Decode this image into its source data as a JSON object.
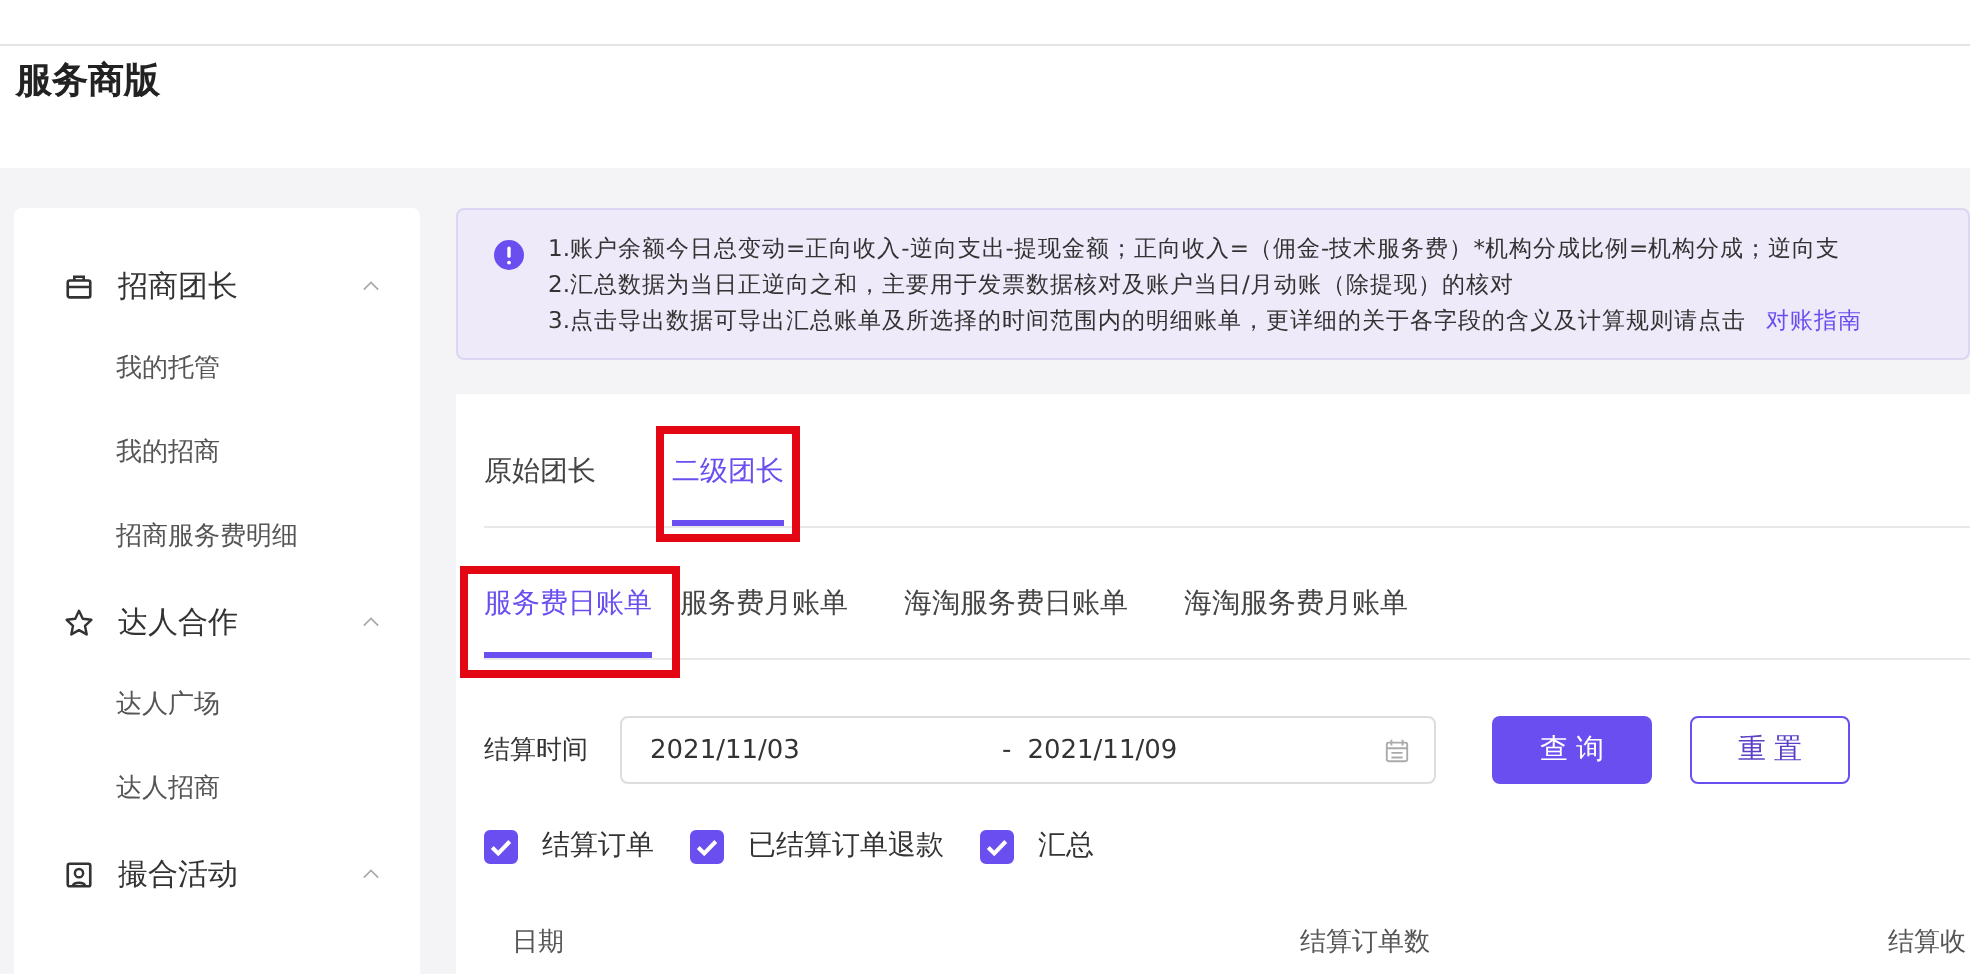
{
  "header": {
    "title": "服务商版"
  },
  "sidebar": {
    "groups": [
      {
        "kind": "briefcase",
        "label": "招商团长",
        "expanded": true,
        "items": [
          {
            "label": "我的托管"
          },
          {
            "label": "我的招商"
          },
          {
            "label": "招商服务费明细"
          }
        ]
      },
      {
        "kind": "star",
        "label": "达人合作",
        "expanded": true,
        "items": [
          {
            "label": "达人广场"
          },
          {
            "label": "达人招商"
          }
        ]
      },
      {
        "kind": "badge",
        "label": "撮合活动",
        "expanded": true
      }
    ]
  },
  "notice": {
    "lines": [
      "1.账户余额今日总变动=正向收入-逆向支出-提现金额；正向收入=（佣金-技术服务费）*机构分成比例=机构分成；逆向支",
      "2.汇总数据为当日正逆向之和，主要用于发票数据核对及账户当日/月动账（除提现）的核对",
      "3.点击导出数据可导出汇总账单及所选择的时间范围内的明细账单，更详细的关于各字段的含义及计算规则请点击"
    ],
    "link": "对账指南"
  },
  "role_tabs": [
    {
      "label": "原始团长",
      "selected": false,
      "highlighted": false
    },
    {
      "label": "二级团长",
      "selected": true,
      "highlighted": true
    }
  ],
  "bill_tabs": [
    {
      "label": "服务费日账单",
      "selected": true,
      "highlighted": true
    },
    {
      "label": "服务费月账单",
      "selected": false,
      "highlighted": false
    },
    {
      "label": "海淘服务费日账单",
      "selected": false,
      "highlighted": false
    },
    {
      "label": "海淘服务费月账单",
      "selected": false,
      "highlighted": false
    }
  ],
  "filter": {
    "label": "结算时间",
    "start": "2021/11/03",
    "separator": "-",
    "end": "2021/11/09",
    "buttons": [
      {
        "kind": "primary",
        "label": "查 询"
      },
      {
        "kind": "outline",
        "label": "重 置"
      }
    ]
  },
  "options": [
    {
      "label": "结算订单",
      "checked": true
    },
    {
      "label": "已结算订单退款",
      "checked": true
    },
    {
      "label": "汇总",
      "checked": true
    }
  ],
  "table": {
    "columns": [
      "日期",
      "结算订单数",
      "结算收"
    ]
  }
}
